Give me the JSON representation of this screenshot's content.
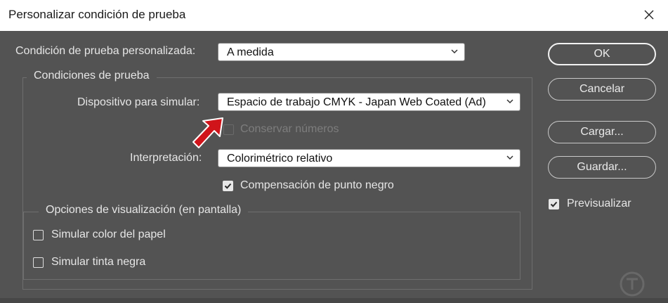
{
  "window": {
    "title": "Personalizar condición de prueba"
  },
  "custom_condition": {
    "label": "Condición de prueba personalizada:",
    "value": "A medida"
  },
  "proof_conditions": {
    "legend": "Condiciones de prueba",
    "device_label": "Dispositivo para simular:",
    "device_value": "Espacio de trabajo CMYK - Japan Web Coated (Ad)",
    "preserve_numbers": {
      "label": "Conservar números",
      "checked": false,
      "enabled": false
    },
    "intent_label": "Interpretación:",
    "intent_value": "Colorimétrico relativo",
    "black_point": {
      "label": "Compensación de punto negro",
      "checked": true
    }
  },
  "display_options": {
    "legend": "Opciones de visualización (en pantalla)",
    "paper_color": {
      "label": "Simular color del papel",
      "checked": false
    },
    "black_ink": {
      "label": "Simular tinta negra",
      "checked": false
    }
  },
  "buttons": {
    "ok": "OK",
    "cancel": "Cancelar",
    "load": "Cargar...",
    "save": "Guardar..."
  },
  "preview": {
    "label": "Previsualizar",
    "checked": true
  },
  "icons": [
    "close-icon",
    "chevron-down-icon",
    "checkmark-icon",
    "red-arrow-annotation",
    "watermark-logo"
  ],
  "colors": {
    "dialog_bg": "#535353",
    "titlebar_bg": "#ffffff",
    "arrow": "#d0141a"
  }
}
